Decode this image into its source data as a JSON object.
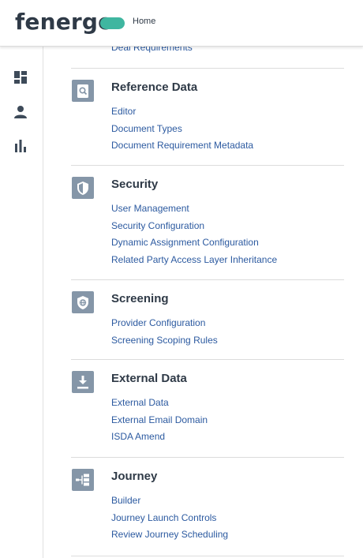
{
  "header": {
    "logo_text": "fenergo",
    "home_label": "Home",
    "brand_color": "#3fb6a0"
  },
  "sidebar": {
    "items": [
      {
        "name": "dashboard",
        "icon": "dashboard-icon"
      },
      {
        "name": "user",
        "icon": "user-icon"
      },
      {
        "name": "reports",
        "icon": "bar-chart-icon"
      }
    ]
  },
  "main": {
    "clipped_link": "Deal Requirements",
    "sections": [
      {
        "title": "Reference Data",
        "icon": "document-search-icon",
        "links": [
          "Editor",
          "Document Types",
          "Document Requirement Metadata"
        ]
      },
      {
        "title": "Security",
        "icon": "shield-icon",
        "links": [
          "User Management",
          "Security Configuration",
          "Dynamic Assignment Configuration",
          "Related Party Access Layer Inheritance"
        ]
      },
      {
        "title": "Screening",
        "icon": "screening-globe-icon",
        "links": [
          "Provider Configuration",
          "Screening Scoping Rules"
        ]
      },
      {
        "title": "External Data",
        "icon": "download-icon",
        "links": [
          "External Data",
          "External Email Domain",
          "ISDA Amend"
        ]
      },
      {
        "title": "Journey",
        "icon": "journey-flow-icon",
        "links": [
          "Builder",
          "Journey Launch Controls",
          "Review Journey Scheduling"
        ]
      }
    ]
  },
  "colors": {
    "text_dark": "#2f3a47",
    "link": "#2c5aa0",
    "icon_bg": "#8596a8",
    "divider": "#dcdcdc"
  }
}
